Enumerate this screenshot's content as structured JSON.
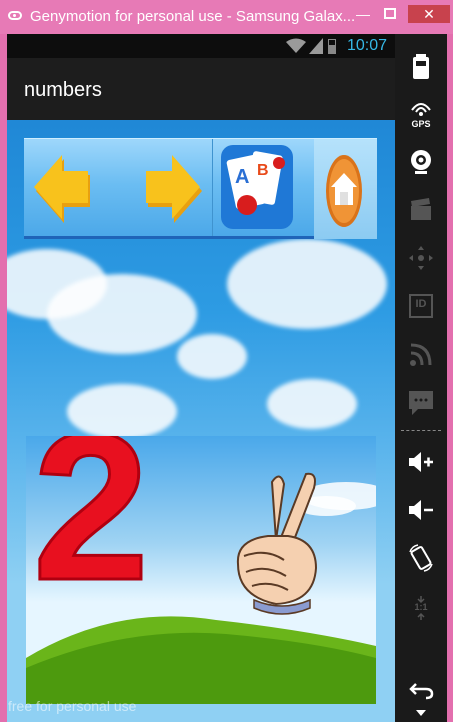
{
  "window": {
    "title": "Genymotion for personal use - Samsung Galax...",
    "minimize": "—",
    "close": "✕"
  },
  "statusbar": {
    "time": "10:07"
  },
  "app": {
    "title": "numbers"
  },
  "toolbar": {
    "buttons": [
      {
        "name": "back-arrow",
        "icon": "left-arrow-icon"
      },
      {
        "name": "forward-arrow",
        "icon": "right-arrow-icon"
      },
      {
        "name": "alphabet-cards",
        "icon": "abc-cards-icon"
      },
      {
        "name": "home",
        "icon": "home-icon"
      }
    ]
  },
  "card": {
    "number": "2",
    "icon": "peace-hand-icon"
  },
  "sidebar": {
    "items": [
      {
        "name": "battery",
        "icon": "battery-icon"
      },
      {
        "name": "gps",
        "icon": "gps-icon",
        "label": "GPS"
      },
      {
        "name": "camera",
        "icon": "webcam-icon"
      },
      {
        "name": "capture",
        "icon": "clapperboard-icon"
      },
      {
        "name": "remote",
        "icon": "dpad-icon"
      },
      {
        "name": "identifiers",
        "icon": "id-icon",
        "label": "ID"
      },
      {
        "name": "network",
        "icon": "rss-icon"
      },
      {
        "name": "sms",
        "icon": "message-icon"
      },
      {
        "name": "volume-up",
        "icon": "volume-up-icon"
      },
      {
        "name": "volume-down",
        "icon": "volume-down-icon"
      },
      {
        "name": "rotate",
        "icon": "rotate-icon"
      },
      {
        "name": "pixel-perfect",
        "icon": "pixel-perfect-icon",
        "label": "1:1"
      },
      {
        "name": "back",
        "icon": "back-icon"
      }
    ]
  },
  "watermark": "free for personal use",
  "colors": {
    "titlebar": "#e77ab6",
    "close": "#c8424d",
    "accent_time": "#36b8e6",
    "number": "#e8101f",
    "arrows": "#f8c21c"
  }
}
